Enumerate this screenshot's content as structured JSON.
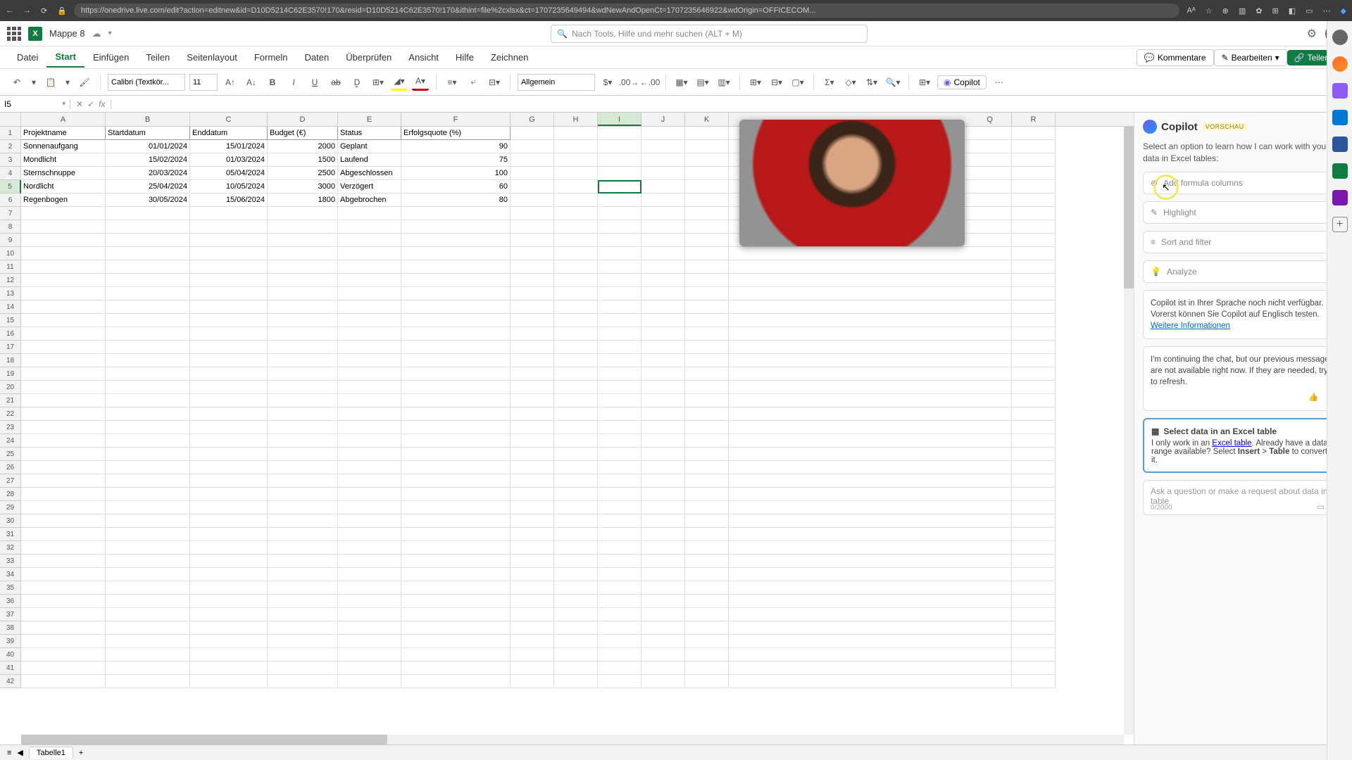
{
  "browser": {
    "url": "https://onedrive.live.com/edit?action=editnew&id=D10D5214C62E3570!170&resid=D10D5214C62E3570!170&ithint=file%2cxlsx&ct=1707235649494&wdNewAndOpenCt=1707235646922&wdOrigin=OFFICECOM..."
  },
  "titlebar": {
    "doc_name": "Mappe 8",
    "search_placeholder": "Nach Tools, Hilfe und mehr suchen (ALT + M)"
  },
  "menu": {
    "items": [
      "Datei",
      "Start",
      "Einfügen",
      "Teilen",
      "Seitenlayout",
      "Formeln",
      "Daten",
      "Überprüfen",
      "Ansicht",
      "Hilfe",
      "Zeichnen"
    ],
    "active": "Start",
    "comments": "Kommentare",
    "edit": "Bearbeiten",
    "share": "Teilen"
  },
  "ribbon": {
    "font": "Calibri (Textkör...",
    "size": "11",
    "number_format": "Allgemein",
    "copilot": "Copilot"
  },
  "formula": {
    "name_box": "I5"
  },
  "columns": [
    "A",
    "B",
    "C",
    "D",
    "E",
    "F",
    "G",
    "H",
    "I",
    "J",
    "K",
    "Q",
    "R"
  ],
  "headers": [
    "Projektname",
    "Startdatum",
    "Enddatum",
    "Budget (€)",
    "Status",
    "Erfolgsquote (%)"
  ],
  "rows": [
    {
      "a": "Sonnenaufgang",
      "b": "01/01/2024",
      "c": "15/01/2024",
      "d": "2000",
      "e": "Geplant",
      "f": "90"
    },
    {
      "a": "Mondlicht",
      "b": "15/02/2024",
      "c": "01/03/2024",
      "d": "1500",
      "e": "Laufend",
      "f": "75"
    },
    {
      "a": "Sternschnuppe",
      "b": "20/03/2024",
      "c": "05/04/2024",
      "d": "2500",
      "e": "Abgeschlossen",
      "f": "100"
    },
    {
      "a": "Nordlicht",
      "b": "25/04/2024",
      "c": "10/05/2024",
      "d": "3000",
      "e": "Verzögert",
      "f": "60"
    },
    {
      "a": "Regenbogen",
      "b": "30/05/2024",
      "c": "15/06/2024",
      "d": "1800",
      "e": "Abgebrochen",
      "f": "80"
    }
  ],
  "copilot": {
    "title": "Copilot",
    "badge": "VORSCHAU",
    "intro": "Select an option to learn how I can work with your data in Excel tables:",
    "opt_formula": "Add formula columns",
    "opt_highlight": "Highlight",
    "opt_sort": "Sort and filter",
    "opt_analyze": "Analyze",
    "lang_msg": "Copilot ist in Ihrer Sprache noch nicht verfügbar. Vorerst können Sie Copilot auf Englisch testen.",
    "lang_link": "Weitere Informationen",
    "continue_msg": "I'm continuing the chat, but our previous messages are not available right now. If they are needed, try to refresh.",
    "select_title": "Select data in an Excel table",
    "select_body_1": "I only work in an ",
    "select_link": "Excel table",
    "select_body_2": ". Already have a data range available? Select ",
    "select_bold1": "Insert",
    "select_gt": " > ",
    "select_bold2": "Table",
    "select_body_3": " to convert it.",
    "input_placeholder": "Ask a question or make a request about data in a table",
    "counter": "0/2000"
  },
  "sheets": {
    "tab1": "Tabelle1"
  }
}
